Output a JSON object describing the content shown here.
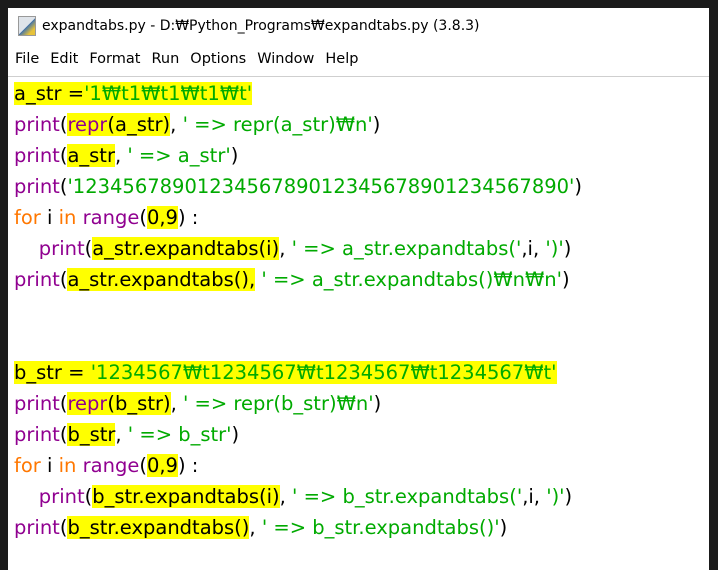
{
  "window": {
    "title": "expandtabs.py - D:₩Python_Programs₩expandtabs.py (3.8.3)"
  },
  "menu": [
    "File",
    "Edit",
    "Format",
    "Run",
    "Options",
    "Window",
    "Help"
  ],
  "colors": {
    "keyword": "#ff7700",
    "builtin": "#900090",
    "string": "#00aa00",
    "highlight": "#ffff00"
  },
  "code": [
    [
      [
        "b",
        "a_str =",
        1
      ],
      [
        "s",
        "'1₩t1₩t1₩t1₩t'",
        1
      ]
    ],
    [
      [
        "p",
        "print",
        0
      ],
      [
        "b",
        "(",
        0
      ],
      [
        "p",
        "repr",
        1
      ],
      [
        "b",
        "(a_str)",
        1
      ],
      [
        "b",
        ", ",
        0
      ],
      [
        "s",
        "' => repr(a_str)₩n'",
        0
      ],
      [
        "b",
        ")",
        0
      ]
    ],
    [
      [
        "p",
        "print",
        0
      ],
      [
        "b",
        "(",
        0
      ],
      [
        "b",
        "a_str",
        1
      ],
      [
        "b",
        ", ",
        0
      ],
      [
        "s",
        "' => a_str'",
        0
      ],
      [
        "b",
        ")",
        0
      ]
    ],
    [
      [
        "p",
        "print",
        0
      ],
      [
        "b",
        "(",
        0
      ],
      [
        "s",
        "'1234567890123456789012345678901234567890'",
        0
      ],
      [
        "b",
        ")",
        0
      ]
    ],
    [
      [
        "k",
        "for",
        0
      ],
      [
        "b",
        " i ",
        0
      ],
      [
        "k",
        "in",
        0
      ],
      [
        "b",
        " ",
        0
      ],
      [
        "p",
        "range",
        0
      ],
      [
        "b",
        "(",
        0
      ],
      [
        "b",
        "0,9",
        1
      ],
      [
        "b",
        ") :",
        0
      ]
    ],
    [
      [
        "b",
        "    ",
        0
      ],
      [
        "p",
        "print",
        0
      ],
      [
        "b",
        "(",
        0
      ],
      [
        "b",
        "a_str.expandtabs(i)",
        1
      ],
      [
        "b",
        ", ",
        0
      ],
      [
        "s",
        "' => a_str.expandtabs('",
        0
      ],
      [
        "b",
        ",i, ",
        0
      ],
      [
        "s",
        "')'",
        0
      ],
      [
        "b",
        ")",
        0
      ]
    ],
    [
      [
        "p",
        "print",
        0
      ],
      [
        "b",
        "(",
        0
      ],
      [
        "b",
        "a_str.expandtabs(),",
        1
      ],
      [
        "b",
        " ",
        0
      ],
      [
        "s",
        "' => a_str.expandtabs()₩n₩n'",
        0
      ],
      [
        "b",
        ")",
        0
      ]
    ],
    [],
    [],
    [
      [
        "b",
        "b_str = ",
        1
      ],
      [
        "s",
        "'1234567₩t1234567₩t1234567₩t1234567₩t'",
        1
      ]
    ],
    [
      [
        "p",
        "print",
        0
      ],
      [
        "b",
        "(",
        0
      ],
      [
        "p",
        "repr",
        1
      ],
      [
        "b",
        "(b_str)",
        1
      ],
      [
        "b",
        ", ",
        0
      ],
      [
        "s",
        "' => repr(b_str)₩n'",
        0
      ],
      [
        "b",
        ")",
        0
      ]
    ],
    [
      [
        "p",
        "print",
        0
      ],
      [
        "b",
        "(",
        0
      ],
      [
        "b",
        "b_str",
        1
      ],
      [
        "b",
        ", ",
        0
      ],
      [
        "s",
        "' => b_str'",
        0
      ],
      [
        "b",
        ")",
        0
      ]
    ],
    [
      [
        "k",
        "for",
        0
      ],
      [
        "b",
        " i ",
        0
      ],
      [
        "k",
        "in",
        0
      ],
      [
        "b",
        " ",
        0
      ],
      [
        "p",
        "range",
        0
      ],
      [
        "b",
        "(",
        0
      ],
      [
        "b",
        "0,9",
        1
      ],
      [
        "b",
        ") :",
        0
      ]
    ],
    [
      [
        "b",
        "    ",
        0
      ],
      [
        "p",
        "print",
        0
      ],
      [
        "b",
        "(",
        0
      ],
      [
        "b",
        "b_str.expandtabs(i)",
        1
      ],
      [
        "b",
        ", ",
        0
      ],
      [
        "s",
        "' => b_str.expandtabs('",
        0
      ],
      [
        "b",
        ",i, ",
        0
      ],
      [
        "s",
        "')'",
        0
      ],
      [
        "b",
        ")",
        0
      ]
    ],
    [
      [
        "p",
        "print",
        0
      ],
      [
        "b",
        "(",
        0
      ],
      [
        "b",
        "b_str.expandtabs()",
        1
      ],
      [
        "b",
        ", ",
        0
      ],
      [
        "s",
        "' => b_str.expandtabs()'",
        0
      ],
      [
        "b",
        ")",
        0
      ]
    ]
  ]
}
